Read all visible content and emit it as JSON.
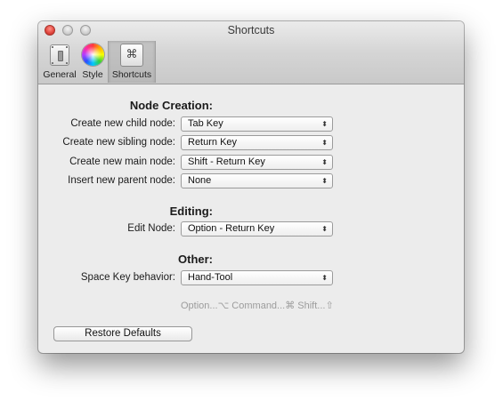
{
  "window": {
    "title": "Shortcuts",
    "controls": [
      "close",
      "minimize",
      "zoom"
    ]
  },
  "toolbar": {
    "items": [
      {
        "label": "General",
        "icon": "switch-icon",
        "selected": false
      },
      {
        "label": "Style",
        "icon": "color-wheel-icon",
        "selected": false
      },
      {
        "label": "Shortcuts",
        "icon": "command-key-icon",
        "selected": true
      }
    ],
    "command_glyph": "⌘"
  },
  "sections": {
    "node_creation": {
      "title": "Node Creation:",
      "rows": [
        {
          "label": "Create new child node:",
          "value": "Tab Key"
        },
        {
          "label": "Create new sibling node:",
          "value": "Return Key"
        },
        {
          "label": "Create new main node:",
          "value": "Shift - Return Key"
        },
        {
          "label": "Insert new parent node:",
          "value": "None"
        }
      ]
    },
    "editing": {
      "title": "Editing:",
      "rows": [
        {
          "label": "Edit Node:",
          "value": "Option - Return Key"
        }
      ]
    },
    "other": {
      "title": "Other:",
      "rows": [
        {
          "label": "Space Key behavior:",
          "value": "Hand-Tool"
        }
      ]
    }
  },
  "popup_arrows": "⬍",
  "legend": "Option...⌥  Command...⌘  Shift...⇧",
  "restore_button": "Restore Defaults",
  "colors": {
    "window_bg": "#ececec",
    "close_red": "#e0443c",
    "hint_gray": "#9c9c9c"
  }
}
